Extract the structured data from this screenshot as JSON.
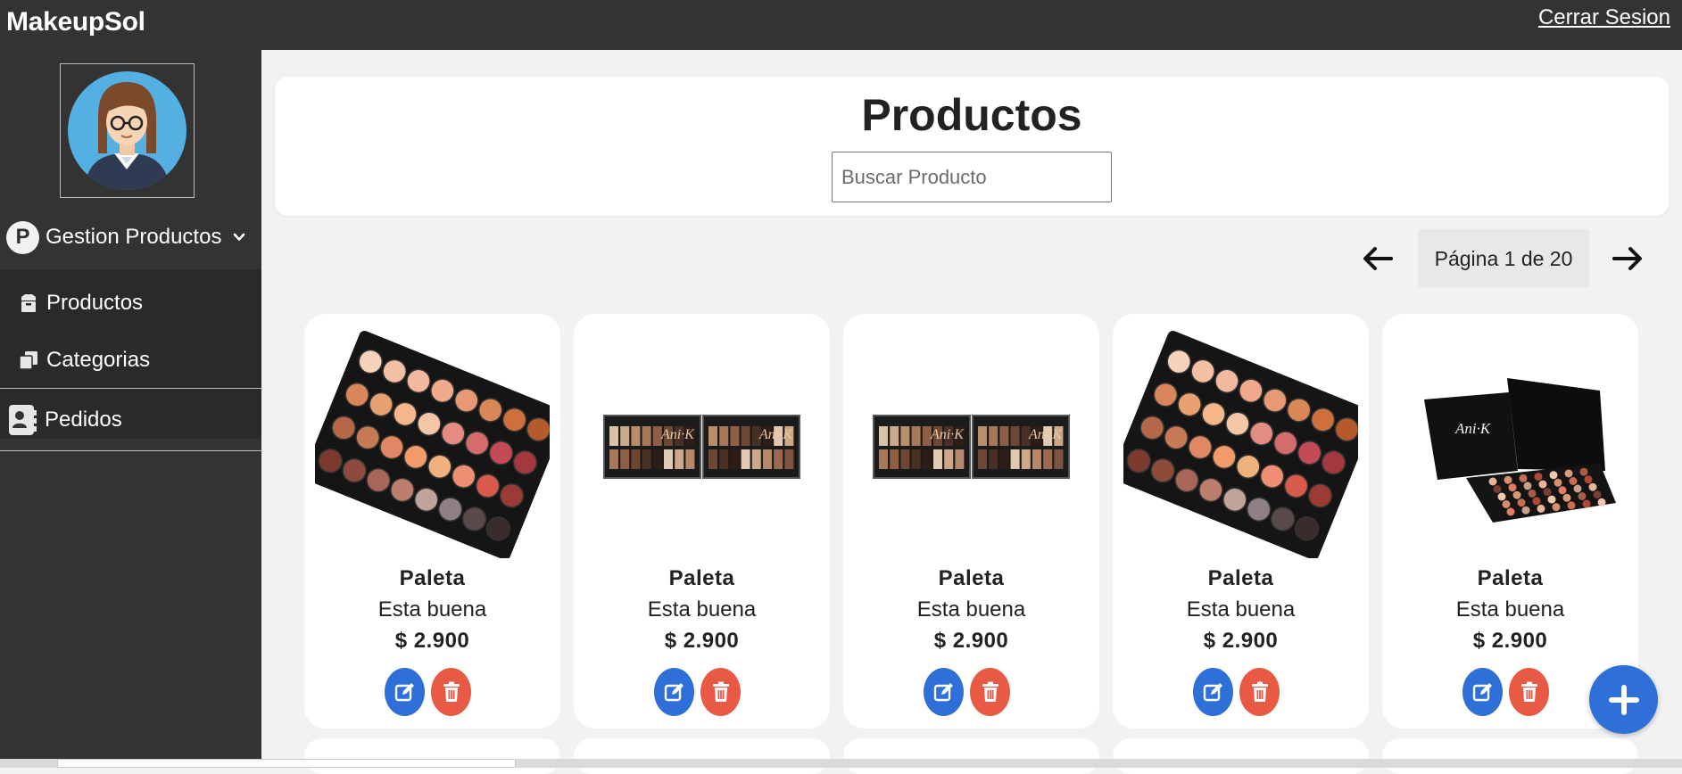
{
  "app": {
    "brand": "MakeupSol",
    "logout_label": "Cerrar Sesion"
  },
  "sidebar": {
    "group_badge": "P",
    "group_label": "Gestion Productos",
    "items": [
      {
        "label": "Productos",
        "icon": "box-icon"
      },
      {
        "label": "Categorias",
        "icon": "copy-icon"
      }
    ],
    "orders_label": "Pedidos",
    "orders_icon": "contact-card-icon"
  },
  "main": {
    "title": "Productos",
    "search_placeholder": "Buscar Producto",
    "pagination": {
      "label": "Página 1 de 20",
      "current": 1,
      "total": 20
    }
  },
  "products": [
    {
      "name": "Paleta",
      "description": "Esta buena",
      "price": "$ 2.900",
      "image": "round-palette"
    },
    {
      "name": "Paleta",
      "description": "Esta buena",
      "price": "$ 2.900",
      "image": "open-palette"
    },
    {
      "name": "Paleta",
      "description": "Esta buena",
      "price": "$ 2.900",
      "image": "open-palette"
    },
    {
      "name": "Paleta",
      "description": "Esta buena",
      "price": "$ 2.900",
      "image": "round-palette"
    },
    {
      "name": "Paleta",
      "description": "Esta buena",
      "price": "$ 2.900",
      "image": "box-palette"
    }
  ],
  "colors": {
    "topbar": "#333333",
    "sidebar": "#333333",
    "submenu": "#2a2a2a",
    "edit_button": "#2f6fd8",
    "delete_button": "#e95a44",
    "fab": "#2f6fd8"
  }
}
